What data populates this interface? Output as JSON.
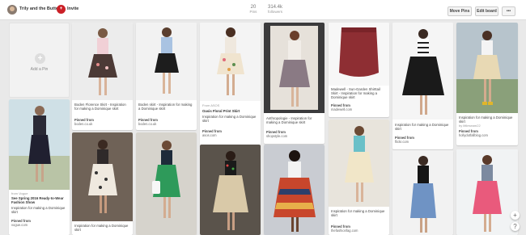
{
  "header": {
    "owner": "Trily and the Buttons",
    "invite_badge": "+",
    "invite": "Invite",
    "pins_count": "20",
    "pins_label": "Pins",
    "followers_count": "314.4k",
    "followers_label": "followers",
    "move_pins": "Move Pins",
    "edit_board": "Edit board",
    "more": "•••"
  },
  "add_pin": {
    "plus": "+",
    "label": "Add a Pin"
  },
  "pins": [
    {
      "title": "Boden Florence Skirt - Inspiration for making a Dominique skirt",
      "pinned_label": "Pinned from",
      "source": "boden.co.uk"
    },
    {
      "title": "Boden skirt - Inspiration for making a Dominique skirt",
      "pinned_label": "Pinned from",
      "source": "boden.co.uk"
    },
    {
      "credit": "From ASOS",
      "title": "Oasis Floral Print Skirt",
      "desc": "Inspiration for making a Dominique skirt",
      "pinned_label": "Pinned from",
      "source": "asos.com"
    },
    {
      "title": "Anthropologie - Inspiration for making a Dominique skirt",
      "pinned_label": "Pinned from",
      "source": "shopstyle.com"
    },
    {
      "title": "Madewell - Sun-Garden Shirttail Skirt - Inspiration for making a Dominique skirt",
      "pinned_label": "Pinned from",
      "source": "madewell.com"
    },
    {
      "title": "Inspiration for making a Dominique skirt",
      "pinned_label": "Pinned from",
      "source": "flickr.com"
    },
    {
      "title": "Inspiration for making a Dominique skirt",
      "credit": "by littleseam22",
      "pinned_label": "Pinned from",
      "source": "hollydotfallblog.com"
    },
    {
      "credit": "from Vogue",
      "title": "See Spring 2016 Ready-to-Wear Fashion Show",
      "desc": "Inspiration for making a Dominique skirt",
      "pinned_label": "Pinned from",
      "source": "vogue.com"
    },
    {
      "title": "Inspiration for making a Dominique skirt"
    },
    {
      "title": "Inspiration for making a Dominique skirt",
      "pinned_label": "Pinned from",
      "source": "thefashionfag.com"
    }
  ],
  "float_buttons": {
    "up": "+",
    "help": "?"
  },
  "colors": {
    "accent": "#cb2027",
    "background": "#e9e9e9"
  }
}
